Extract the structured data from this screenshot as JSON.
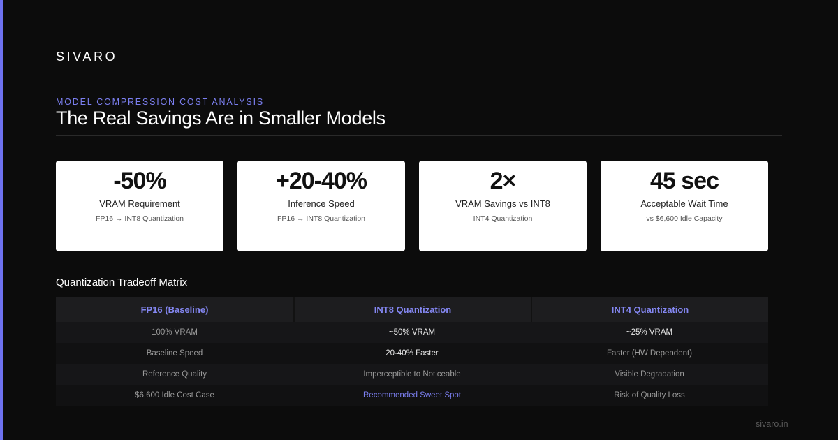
{
  "brand": "SIVARO",
  "eyebrow": "MODEL COMPRESSION COST ANALYSIS",
  "headline": "The Real Savings Are in Smaller Models",
  "cards": [
    {
      "value": "-50%",
      "label": "VRAM Requirement",
      "sub": "FP16 → INT8 Quantization"
    },
    {
      "value": "+20-40%",
      "label": "Inference Speed",
      "sub": "FP16 → INT8 Quantization"
    },
    {
      "value": "2×",
      "label": "VRAM Savings vs INT8",
      "sub": "INT4 Quantization"
    },
    {
      "value": "45 sec",
      "label": "Acceptable Wait Time",
      "sub": "vs $6,600 Idle Capacity"
    }
  ],
  "matrix": {
    "title": "Quantization Tradeoff Matrix",
    "headers": [
      "FP16 (Baseline)",
      "INT8 Quantization",
      "INT4 Quantization"
    ],
    "rows": [
      [
        "100% VRAM",
        "~50% VRAM",
        "~25% VRAM"
      ],
      [
        "Baseline Speed",
        "20-40% Faster",
        "Faster (HW Dependent)"
      ],
      [
        "Reference Quality",
        "Imperceptible to Noticeable",
        "Visible Degradation"
      ],
      [
        "$6,600 Idle Cost Case",
        "Recommended Sweet Spot",
        "Risk of Quality Loss"
      ]
    ]
  },
  "footer": "sivaro.in",
  "colors": {
    "accent": "#6e72f0",
    "background": "#0c0c0c",
    "card": "#ffffff"
  }
}
